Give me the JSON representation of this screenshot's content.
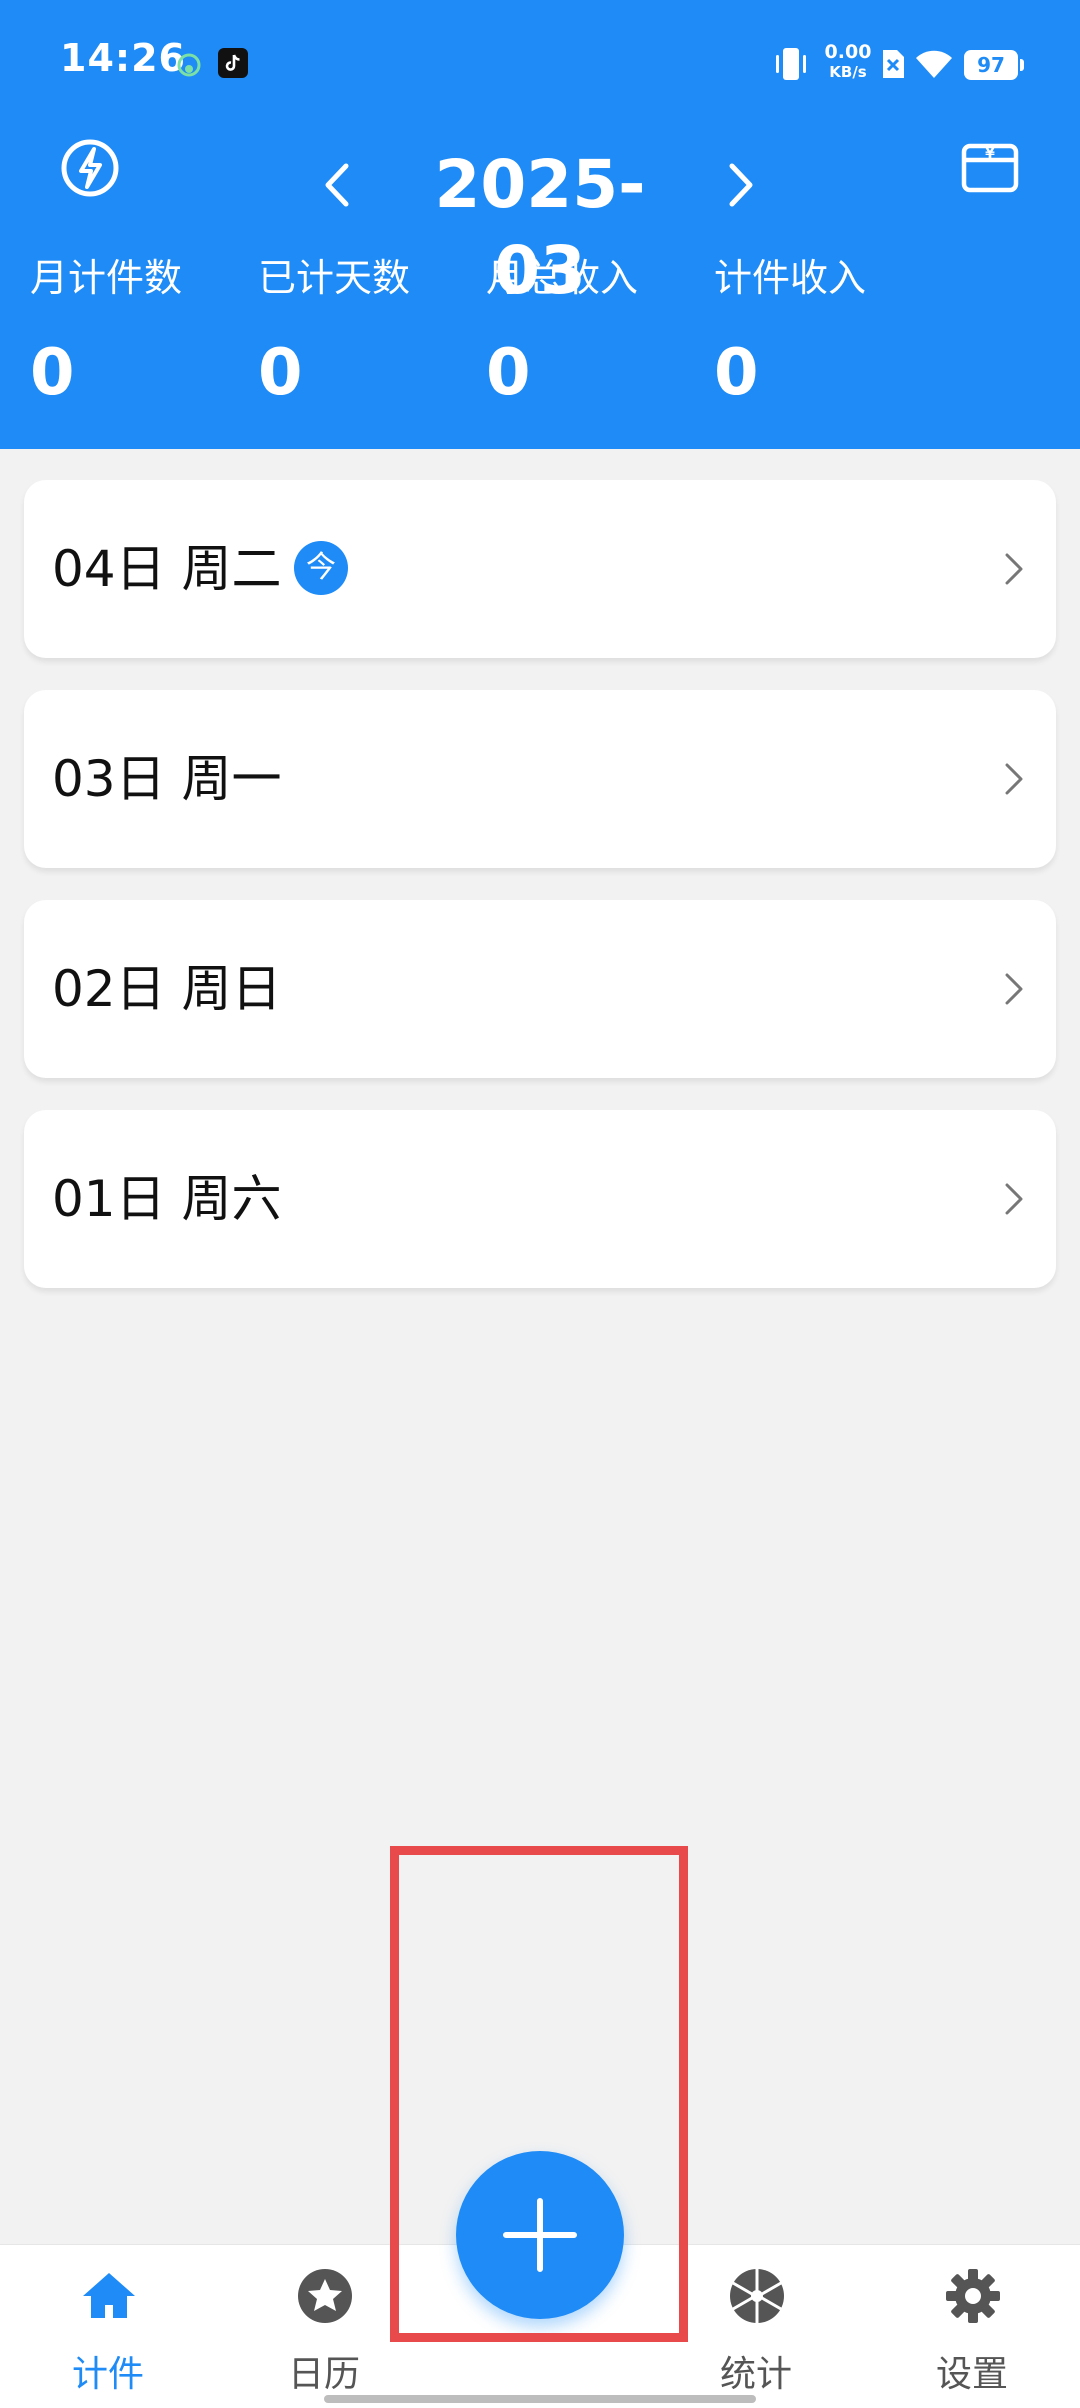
{
  "status_bar": {
    "time": "14:26",
    "net_speed_value": "0.00",
    "net_speed_unit": "KB/s",
    "battery": "97"
  },
  "header": {
    "month": "2025-03",
    "prev_icon": "chevron-left-icon",
    "next_icon": "chevron-right-icon",
    "left_icon": "flash-icon",
    "right_icon": "wallet-icon",
    "stats": [
      {
        "label": "月计件数",
        "value": "0"
      },
      {
        "label": "已计天数",
        "value": "0"
      },
      {
        "label": "月总收入",
        "value": "0"
      },
      {
        "label": "计件收入",
        "value": "0"
      }
    ]
  },
  "days": [
    {
      "label": "04日 周二",
      "badge": "今"
    },
    {
      "label": "03日 周一"
    },
    {
      "label": "02日 周日"
    },
    {
      "label": "01日 周六"
    }
  ],
  "fab_icon": "plus-icon",
  "bottom_nav": [
    {
      "label": "计件",
      "icon": "home-icon",
      "active": true
    },
    {
      "label": "日历",
      "icon": "star-icon"
    },
    {
      "label": "统计",
      "icon": "aperture-icon"
    },
    {
      "label": "设置",
      "icon": "gear-icon"
    }
  ],
  "colors": {
    "accent": "#1e8bf6",
    "background": "#f2f2f2",
    "highlight": "#e8494b"
  }
}
